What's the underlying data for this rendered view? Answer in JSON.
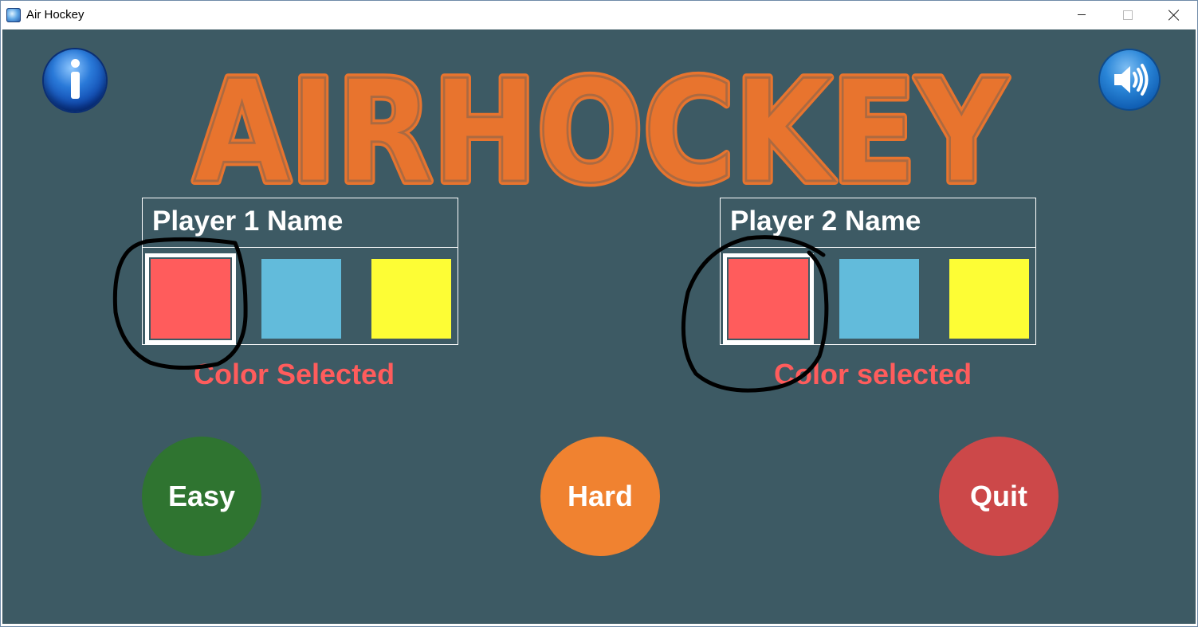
{
  "window": {
    "title": "Air Hockey"
  },
  "header": {
    "logo_text": "AIRHOCKEY",
    "info_icon": "info-icon",
    "sound_icon": "speaker-icon"
  },
  "players": [
    {
      "name_label": "Player 1 Name",
      "status_text": "Color Selected",
      "selected_index": 0,
      "swatches": [
        "#ff5c5c",
        "#62bbdb",
        "#fdfd35"
      ]
    },
    {
      "name_label": "Player 2 Name",
      "status_text": "Color selected",
      "selected_index": 0,
      "swatches": [
        "#ff5c5c",
        "#62bbdb",
        "#fdfd35"
      ]
    }
  ],
  "buttons": {
    "easy": "Easy",
    "hard": "Hard",
    "quit": "Quit"
  },
  "colors": {
    "background": "#3d5a64",
    "logo": "#e8742e",
    "status_text": "#ff5c5c",
    "easy": "#2f7430",
    "hard": "#f08230",
    "quit": "#cc4849",
    "annotation": "#000000"
  }
}
